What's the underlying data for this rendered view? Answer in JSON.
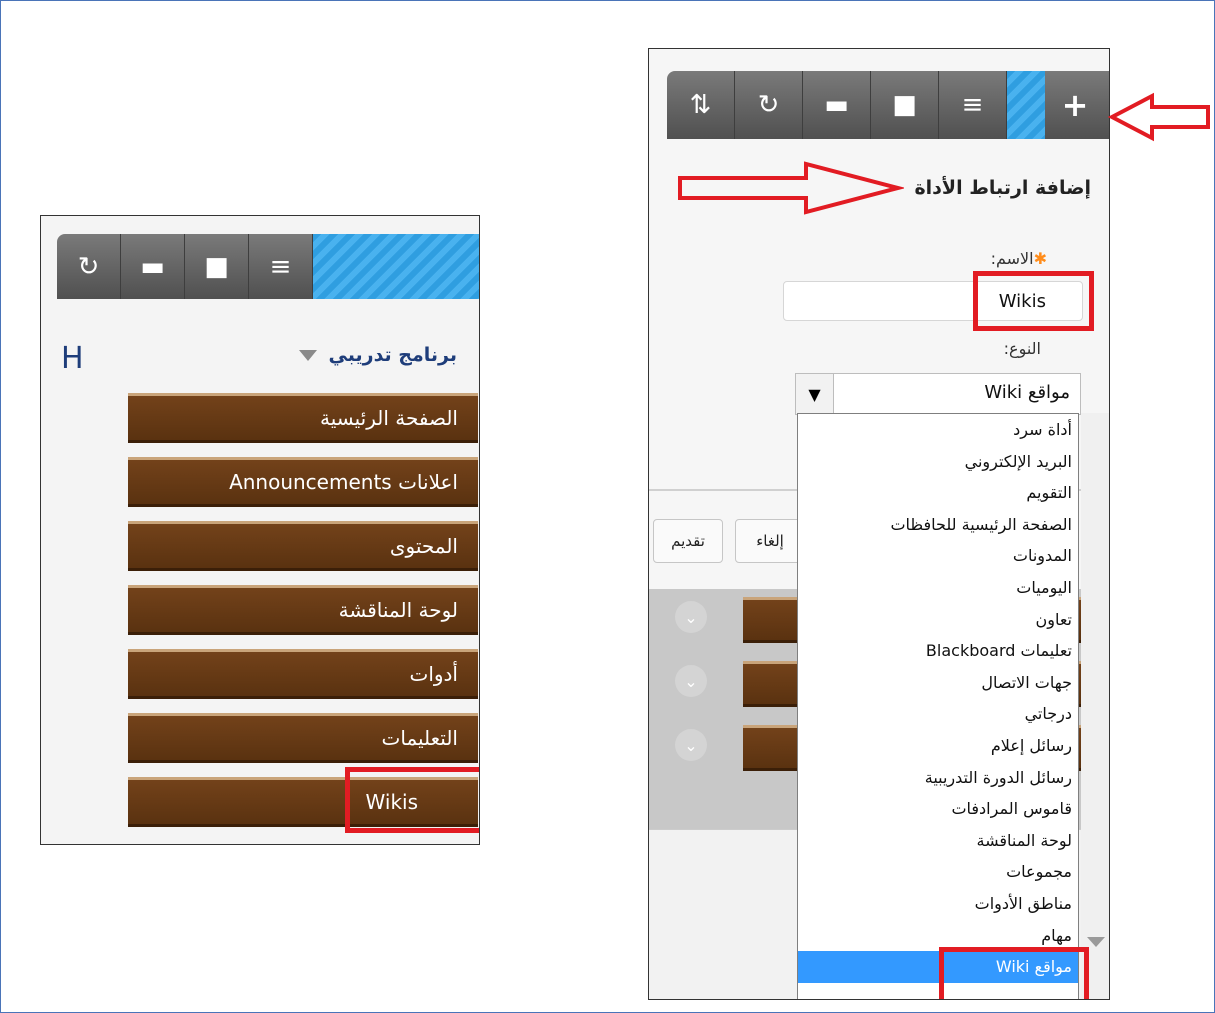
{
  "left_panel": {
    "toolbar_icons": [
      "refresh-icon",
      "window-icon",
      "folder-icon",
      "list-icon"
    ],
    "course_letter": "H",
    "course_title": "برنامج تدريبي",
    "menu_items": [
      "الصفحة الرئيسية",
      "اعلانات Announcements",
      "المحتوى",
      "لوحة المناقشة",
      "أدوات",
      "التعليمات",
      "Wikis"
    ]
  },
  "right_panel": {
    "toolbar_icons": [
      "sort-icon",
      "refresh-icon",
      "window-icon",
      "folder-icon",
      "list-icon",
      "plus-icon"
    ],
    "form_title": "إضافة ارتباط الأداة",
    "name_label": "الاسم:",
    "name_value": "Wikis",
    "type_label": "النوع:",
    "type_value": "مواقع Wiki",
    "submit_label": "تقديم",
    "cancel_label": "إلغاء",
    "type_options": [
      "أداة سرد",
      "البريد الإلكتروني",
      "التقويم",
      "الصفحة الرئيسية للحافظات",
      "المدونات",
      "اليوميات",
      "تعاون",
      "تعليمات Blackboard",
      "جهات الاتصال",
      "درجاتي",
      "رسائل إعلام",
      "رسائل الدورة التدريبية",
      "قاموس المرادفات",
      "لوحة المناقشة",
      "مجموعات",
      "مناطق الأدوات",
      "مهام",
      "مواقع Wiki"
    ],
    "selected_option_index": 17
  },
  "colors": {
    "menu_brown": "#5a3210",
    "highlight_red": "#e21c23",
    "toolbar_gray": "#505050",
    "stripe_blue": "#2f9ee0",
    "selected_blue": "#3399ff"
  }
}
